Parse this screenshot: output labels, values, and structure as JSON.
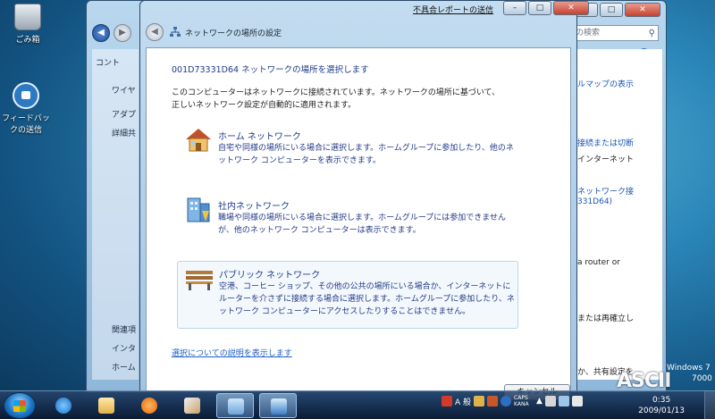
{
  "desktop": {
    "icons": [
      {
        "label": "ごみ箱"
      },
      {
        "label": "フィードバックの送信"
      }
    ]
  },
  "back_window": {
    "search_placeholder": "の検索",
    "left_panel_title": "コント",
    "left_items": [
      "ワイヤ",
      "アダプ",
      "詳細共"
    ],
    "left_bottom_items": [
      "関連項",
      "インタ",
      "ホーム"
    ],
    "right_items": [
      "ルマップの表示",
      "接続または切断",
      "インターネット",
      "ネットワーク接",
      "331D64)",
      "a router or",
      "または再確立し",
      "か、共有設定を"
    ]
  },
  "dialog": {
    "title": "ネットワークの場所の設定",
    "report_link": "不具合レポートの送信",
    "heading": "001D73331D64 ネットワークの場所を選択します",
    "intro": "このコンピューターはネットワークに接続されています。ネットワークの場所に基づいて、正しいネットワーク設定が自動的に適用されます。",
    "options": [
      {
        "title": "ホーム ネットワーク",
        "desc": "自宅や同様の場所にいる場合に選択します。ホームグループに参加したり、他のネットワーク コンピューターを表示できます。"
      },
      {
        "title": "社内ネットワーク",
        "desc": "職場や同様の場所にいる場合に選択します。ホームグループには参加できませんが、他のネットワーク コンピューターは表示できます。"
      },
      {
        "title": "パブリック ネットワーク",
        "desc": "空港、コーヒー ショップ、その他の公共の場所にいる場合か、インターネットにルーターを介さずに接続する場合に選択します。ホームグループに参加したり、ネットワーク コンピューターにアクセスしたりすることはできません。"
      }
    ],
    "help_link": "選択についての説明を表示します",
    "cancel_label": "キャンセル"
  },
  "taskbar": {
    "ime": "A 般",
    "caps": "CAPS KANA",
    "time": "0:35",
    "date": "2009/01/13"
  },
  "watermark": {
    "windows_line1": "Windows 7",
    "windows_line2": "7000",
    "ascii": "ASCII"
  },
  "colors": {
    "link_blue": "#1d5fc5",
    "heading_blue": "#1d3b8c"
  }
}
